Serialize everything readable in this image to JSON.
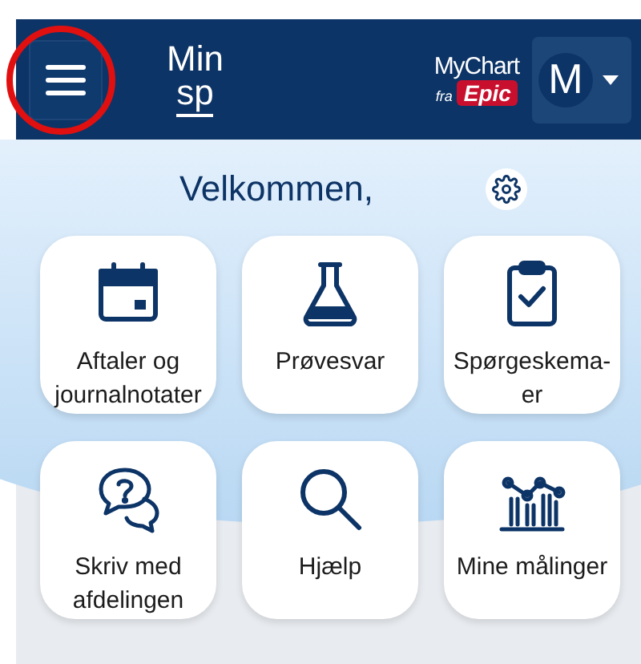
{
  "header": {
    "logo_lines": [
      "Min",
      "sp"
    ],
    "mychart": {
      "name": "MyChart",
      "by": "fra",
      "brand": "Epic"
    },
    "avatar": {
      "initial": "M"
    }
  },
  "welcome": "Velkommen,",
  "tiles": [
    {
      "kind": "calendar",
      "label": "Aftaler og journalnotater"
    },
    {
      "kind": "flask",
      "label": "Prøvesvar"
    },
    {
      "kind": "clipboard",
      "label": "Spørgeskema-er"
    },
    {
      "kind": "chat",
      "label": "Skriv med afdelingen"
    },
    {
      "kind": "search",
      "label": "Hjælp"
    },
    {
      "kind": "chart",
      "label": "Mine målinger"
    }
  ]
}
